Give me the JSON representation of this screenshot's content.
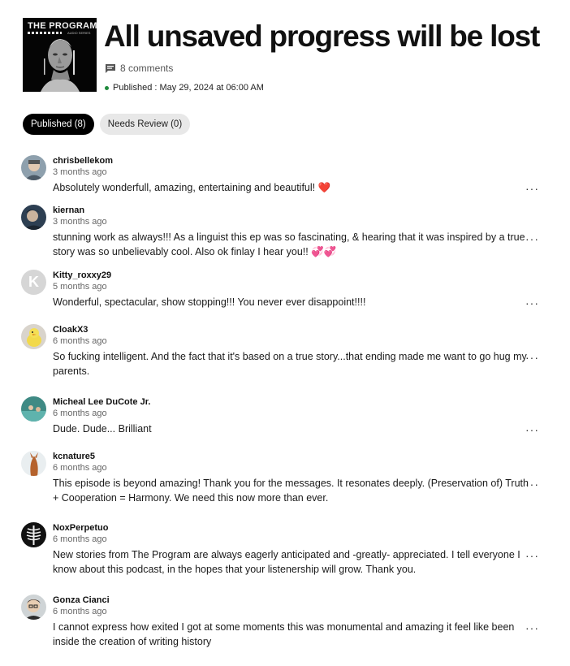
{
  "episode": {
    "cover_title": "THE PROGRAM",
    "cover_subtitle": "AUDIO SERIES",
    "title": "All unsaved progress will be lost",
    "comments_count": "8 comments",
    "published": "Published : May 29, 2024 at 06:00 AM",
    "published_dot_color": "#1f8a3c"
  },
  "tabs": [
    {
      "label": "Published (8)",
      "active": true
    },
    {
      "label": "Needs Review (0)",
      "active": false
    }
  ],
  "comments": [
    {
      "user": "chrisbellekom",
      "time": "3 months ago",
      "text": "Absolutely wonderfull, amazing, entertaining and beautiful! ❤️",
      "menu": "···"
    },
    {
      "user": "kiernan",
      "time": "3 months ago",
      "text": "stunning work as always!!! As a linguist this ep was so fascinating, & hearing that it was inspired by a true story was so unbelievably cool. Also ok finlay I hear you!! 💞💞",
      "menu": "···"
    },
    {
      "user": "Kitty_roxxy29",
      "time": "5 months ago",
      "text": "Wonderful, spectacular, show stopping!!! You never ever disappoint!!!!",
      "menu": "···",
      "initial": "K"
    },
    {
      "user": "CloakX3",
      "time": "6 months ago",
      "text": "So fucking intelligent. And the fact that it's based on a true story...that ending made me want to go hug my parents.",
      "menu": "···"
    },
    {
      "user": "Micheal Lee DuCote Jr.",
      "time": "6 months ago",
      "text": "Dude. Dude... Brilliant",
      "menu": "···"
    },
    {
      "user": "kcnature5",
      "time": "6 months ago",
      "text": "This episode is beyond amazing! Thank you for the messages. It resonates deeply. (Preservation of) Truth + Cooperation = Harmony. We need this now more than ever.",
      "menu": "···"
    },
    {
      "user": "NoxPerpetuo",
      "time": "6 months ago",
      "text": "New stories from The Program are always eagerly anticipated and -greatly- appreciated. I tell everyone I know about this podcast, in the hopes that your listenership will grow. Thank you.",
      "menu": "···"
    },
    {
      "user": "Gonza Cianci",
      "time": "6 months ago",
      "text": "I cannot express how exited I got at some moments this was monumental and amazing it feel like been inside the creation of writing history",
      "menu": "···"
    }
  ]
}
